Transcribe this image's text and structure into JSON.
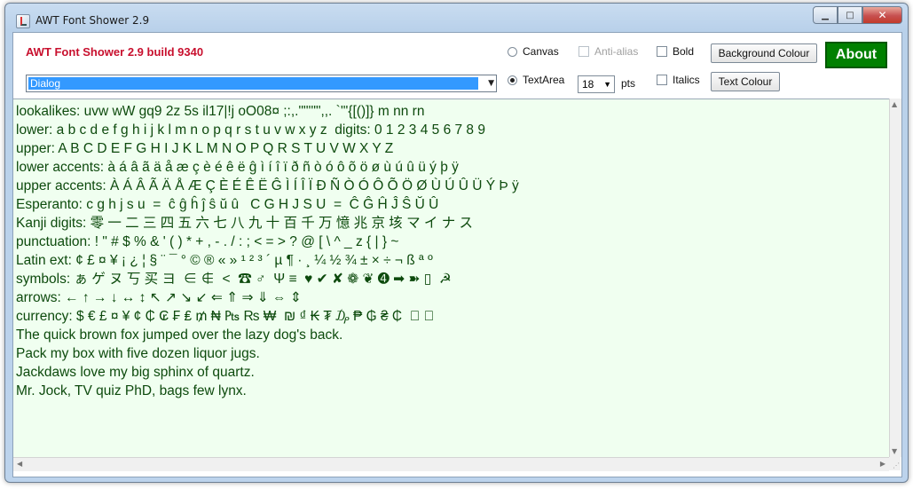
{
  "window": {
    "title": "AWT Font Shower 2.9",
    "min_glyph": "▁",
    "max_glyph": "□",
    "close_glyph": "✕"
  },
  "toolbar": {
    "build_label": "AWT Font Shower 2.9 build 9340",
    "font_value": "Dialog",
    "dropdown_glyph": "▼",
    "radio_canvas": "Canvas",
    "radio_textarea": "TextArea",
    "anti_alias": "Anti-alias",
    "bold": "Bold",
    "italics": "Italics",
    "size_value": "18",
    "pts": "pts",
    "background_colour": "Background Colour",
    "text_colour": "Text Colour",
    "about": "About"
  },
  "textarea": {
    "lines": [
      "lookalikes: uvw wW gq9 2z 5s il17|!j oO08¤ ;:,.\"\"'\"\",,. `'\"{[()]} m nn rn",
      "lower: a b c d e f g h i j k l m n o p q r s t u v w x y z  digits: 0 1 2 3 4 5 6 7 8 9",
      "upper: A B C D E F G H I J K L M N O P Q R S T U V W X Y Z",
      "lower accents: à á â ã ä å æ ç è é ê ë ĝ ì í î ï ð ñ ò ó ô õ ö ø ù ú û ü ý þ ÿ",
      "upper accents: À Á Â Ã Ä Å Æ Ç È É Ê Ë Ĝ Ì Í Î Ï Ð Ñ Ò Ó Ô Õ Ö Ø Ù Ú Û Ü Ý Þ ÿ",
      "Esperanto: c g h j s u  =  ĉ ĝ ĥ ĵ ŝ ŭ û   C G H J S U  =  Ĉ Ĝ Ĥ Ĵ Ŝ Ŭ Û",
      "Kanji digits: 零 一 二 三 四 五 六 七 八 九 十 百 千 万 憶 兆 京 垓 マ イ ナ ス",
      "punctuation: ! \" # $ % & ' ( ) * + , - . / : ; < = > ? @ [ \\ ^ _ z { | } ~",
      "Latin ext: ¢ £ ¤ ¥ ¡ ¿ ¦ § ¨ ¯ ° © ® « » ¹ ² ³ ´ µ ¶ · ¸ ¼ ½ ¾ ± × ÷ ¬ ß ª º",
      "symbols: ぁ ゲ ヌ 丂 买 ヨ  ∈ ∉  <  ☎ ♂  Ψ ≡  ♥ ✔ ✘ ❁ ❦ ➍ ➡ ➽ ▯  ☭",
      "arrows: ← ↑ → ↓ ↔ ↕ ↖ ↗ ↘ ↙ ⇐ ⇑ ⇒ ⇓ ⇔ ⇕",
      "currency: $ € £ ¤ ¥ ¢ ₵ ₢ ₣ ₤ ₥ ₦ ₧ ₨ ₩  ₪ ₫ ₭ ₮ ₯ ₱ ₲ ₴ ₵  ⃒ ⃒",
      "The quick brown fox jumped over the lazy dog's back.",
      "Pack my box with five dozen liquor jugs.",
      "Jackdaws love my big sphinx of quartz.",
      "Mr. Jock, TV quiz PhD, bags few lynx."
    ]
  },
  "scroll": {
    "up": "▲",
    "down": "▼",
    "left": "◀",
    "right": "▶",
    "grip": "⋰"
  }
}
